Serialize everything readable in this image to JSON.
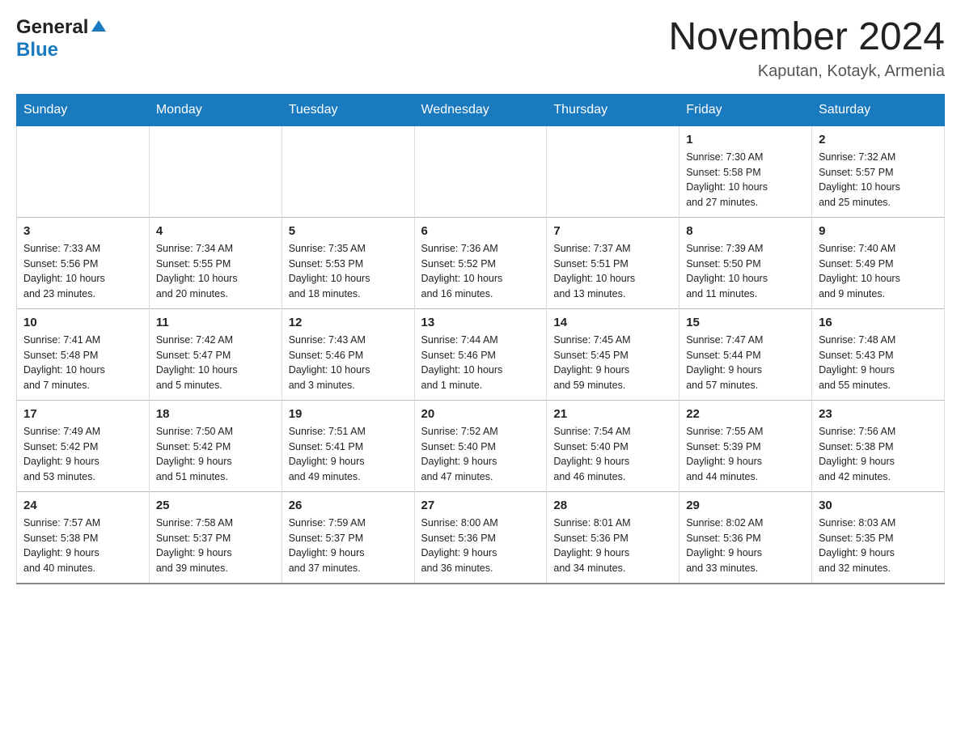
{
  "header": {
    "logo_general": "General",
    "logo_blue": "Blue",
    "month_title": "November 2024",
    "location": "Kaputan, Kotayk, Armenia"
  },
  "days_of_week": [
    "Sunday",
    "Monday",
    "Tuesday",
    "Wednesday",
    "Thursday",
    "Friday",
    "Saturday"
  ],
  "weeks": [
    [
      {
        "day": "",
        "info": ""
      },
      {
        "day": "",
        "info": ""
      },
      {
        "day": "",
        "info": ""
      },
      {
        "day": "",
        "info": ""
      },
      {
        "day": "",
        "info": ""
      },
      {
        "day": "1",
        "info": "Sunrise: 7:30 AM\nSunset: 5:58 PM\nDaylight: 10 hours\nand 27 minutes."
      },
      {
        "day": "2",
        "info": "Sunrise: 7:32 AM\nSunset: 5:57 PM\nDaylight: 10 hours\nand 25 minutes."
      }
    ],
    [
      {
        "day": "3",
        "info": "Sunrise: 7:33 AM\nSunset: 5:56 PM\nDaylight: 10 hours\nand 23 minutes."
      },
      {
        "day": "4",
        "info": "Sunrise: 7:34 AM\nSunset: 5:55 PM\nDaylight: 10 hours\nand 20 minutes."
      },
      {
        "day": "5",
        "info": "Sunrise: 7:35 AM\nSunset: 5:53 PM\nDaylight: 10 hours\nand 18 minutes."
      },
      {
        "day": "6",
        "info": "Sunrise: 7:36 AM\nSunset: 5:52 PM\nDaylight: 10 hours\nand 16 minutes."
      },
      {
        "day": "7",
        "info": "Sunrise: 7:37 AM\nSunset: 5:51 PM\nDaylight: 10 hours\nand 13 minutes."
      },
      {
        "day": "8",
        "info": "Sunrise: 7:39 AM\nSunset: 5:50 PM\nDaylight: 10 hours\nand 11 minutes."
      },
      {
        "day": "9",
        "info": "Sunrise: 7:40 AM\nSunset: 5:49 PM\nDaylight: 10 hours\nand 9 minutes."
      }
    ],
    [
      {
        "day": "10",
        "info": "Sunrise: 7:41 AM\nSunset: 5:48 PM\nDaylight: 10 hours\nand 7 minutes."
      },
      {
        "day": "11",
        "info": "Sunrise: 7:42 AM\nSunset: 5:47 PM\nDaylight: 10 hours\nand 5 minutes."
      },
      {
        "day": "12",
        "info": "Sunrise: 7:43 AM\nSunset: 5:46 PM\nDaylight: 10 hours\nand 3 minutes."
      },
      {
        "day": "13",
        "info": "Sunrise: 7:44 AM\nSunset: 5:46 PM\nDaylight: 10 hours\nand 1 minute."
      },
      {
        "day": "14",
        "info": "Sunrise: 7:45 AM\nSunset: 5:45 PM\nDaylight: 9 hours\nand 59 minutes."
      },
      {
        "day": "15",
        "info": "Sunrise: 7:47 AM\nSunset: 5:44 PM\nDaylight: 9 hours\nand 57 minutes."
      },
      {
        "day": "16",
        "info": "Sunrise: 7:48 AM\nSunset: 5:43 PM\nDaylight: 9 hours\nand 55 minutes."
      }
    ],
    [
      {
        "day": "17",
        "info": "Sunrise: 7:49 AM\nSunset: 5:42 PM\nDaylight: 9 hours\nand 53 minutes."
      },
      {
        "day": "18",
        "info": "Sunrise: 7:50 AM\nSunset: 5:42 PM\nDaylight: 9 hours\nand 51 minutes."
      },
      {
        "day": "19",
        "info": "Sunrise: 7:51 AM\nSunset: 5:41 PM\nDaylight: 9 hours\nand 49 minutes."
      },
      {
        "day": "20",
        "info": "Sunrise: 7:52 AM\nSunset: 5:40 PM\nDaylight: 9 hours\nand 47 minutes."
      },
      {
        "day": "21",
        "info": "Sunrise: 7:54 AM\nSunset: 5:40 PM\nDaylight: 9 hours\nand 46 minutes."
      },
      {
        "day": "22",
        "info": "Sunrise: 7:55 AM\nSunset: 5:39 PM\nDaylight: 9 hours\nand 44 minutes."
      },
      {
        "day": "23",
        "info": "Sunrise: 7:56 AM\nSunset: 5:38 PM\nDaylight: 9 hours\nand 42 minutes."
      }
    ],
    [
      {
        "day": "24",
        "info": "Sunrise: 7:57 AM\nSunset: 5:38 PM\nDaylight: 9 hours\nand 40 minutes."
      },
      {
        "day": "25",
        "info": "Sunrise: 7:58 AM\nSunset: 5:37 PM\nDaylight: 9 hours\nand 39 minutes."
      },
      {
        "day": "26",
        "info": "Sunrise: 7:59 AM\nSunset: 5:37 PM\nDaylight: 9 hours\nand 37 minutes."
      },
      {
        "day": "27",
        "info": "Sunrise: 8:00 AM\nSunset: 5:36 PM\nDaylight: 9 hours\nand 36 minutes."
      },
      {
        "day": "28",
        "info": "Sunrise: 8:01 AM\nSunset: 5:36 PM\nDaylight: 9 hours\nand 34 minutes."
      },
      {
        "day": "29",
        "info": "Sunrise: 8:02 AM\nSunset: 5:36 PM\nDaylight: 9 hours\nand 33 minutes."
      },
      {
        "day": "30",
        "info": "Sunrise: 8:03 AM\nSunset: 5:35 PM\nDaylight: 9 hours\nand 32 minutes."
      }
    ]
  ]
}
